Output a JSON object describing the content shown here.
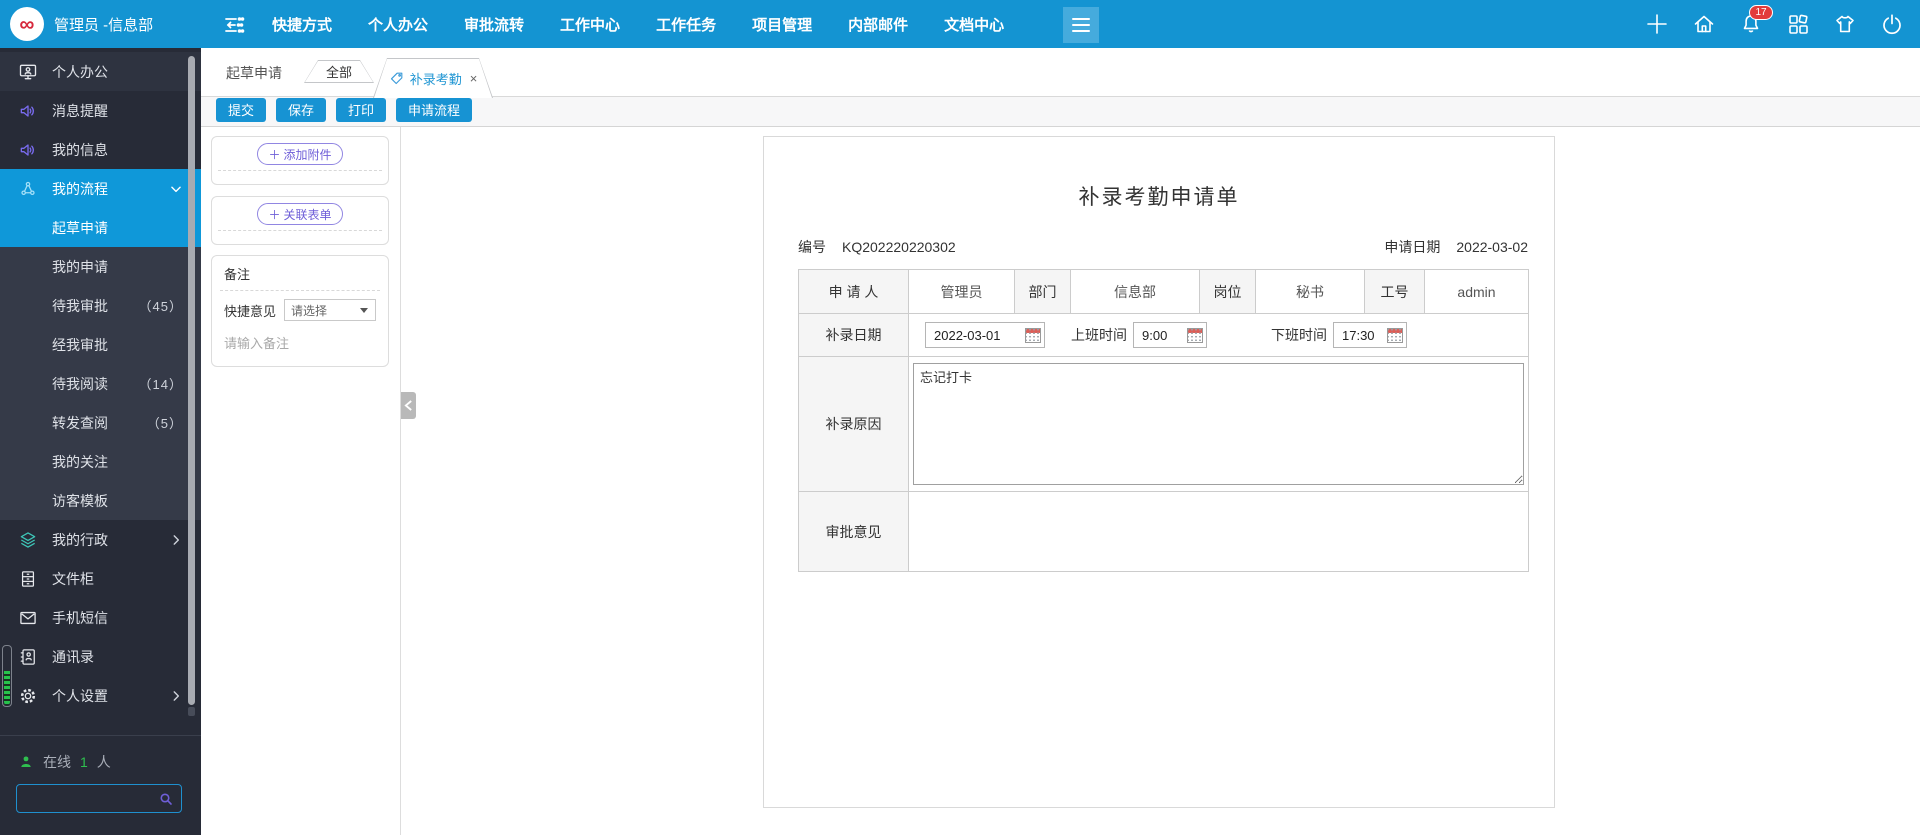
{
  "colors": {
    "topbar_blue": "#1494d2",
    "burger_blue": "#45abdd",
    "sidebar_dark": "#272b37",
    "submenu_dark": "#353a48",
    "highlight_blue": "#0f98d9",
    "button_blue": "#1793d3",
    "accent_purple": "#6f5fd8",
    "badge_red": "#e23b3b",
    "online_green": "#2fbf4f"
  },
  "topbar": {
    "logo_glyph": "∞",
    "user": "管理员 -信息部",
    "menu": [
      "快捷方式",
      "个人办公",
      "审批流转",
      "工作中心",
      "工作任务",
      "项目管理",
      "内部邮件",
      "文档中心"
    ],
    "notification_count": "17"
  },
  "sidebar": {
    "items": [
      {
        "id": "personal-office",
        "label": "个人办公",
        "icon": "monitor-user",
        "section": true
      },
      {
        "id": "message-remind",
        "label": "消息提醒",
        "icon": "speaker",
        "iconClass": "purple"
      },
      {
        "id": "my-info",
        "label": "我的信息",
        "icon": "speaker",
        "iconClass": "purple"
      },
      {
        "id": "my-workflow",
        "label": "我的流程",
        "icon": "flow",
        "active": true,
        "chevron": "down"
      },
      {
        "id": "draft-apply",
        "label": "起草申请",
        "sub": true,
        "active": true
      },
      {
        "id": "my-apply",
        "label": "我的申请",
        "sub": true
      },
      {
        "id": "wait-my-approve",
        "label": "待我审批",
        "sub": true,
        "count": "（45）"
      },
      {
        "id": "approved-by-me",
        "label": "经我审批",
        "sub": true
      },
      {
        "id": "wait-my-read",
        "label": "待我阅读",
        "sub": true,
        "count": "（14）"
      },
      {
        "id": "forward-review",
        "label": "转发查阅",
        "sub": true,
        "count": "（5）"
      },
      {
        "id": "my-follow",
        "label": "我的关注",
        "sub": true
      },
      {
        "id": "visitor-template",
        "label": "访客模板",
        "sub": true
      },
      {
        "id": "my-admin",
        "label": "我的行政",
        "icon": "layers",
        "iconClass": "teal",
        "chevron": "right"
      },
      {
        "id": "file-cabinet",
        "label": "文件柜",
        "icon": "cabinet"
      },
      {
        "id": "sms",
        "label": "手机短信",
        "icon": "mail"
      },
      {
        "id": "contacts",
        "label": "通讯录",
        "icon": "contacts"
      },
      {
        "id": "personal-settings",
        "label": "个人设置",
        "icon": "gear",
        "chevron": "right"
      }
    ],
    "online_label": "在线",
    "online_count": "1",
    "online_unit": "人"
  },
  "tabs": {
    "root_label": "起草申请",
    "all_label": "全部",
    "active_label": "补录考勤",
    "close_glyph": "×"
  },
  "toolbar": {
    "buttons": [
      "提交",
      "保存",
      "打印",
      "申请流程"
    ]
  },
  "side_panel": {
    "plus_glyph": "＋",
    "add_attachment_label": "添加附件",
    "link_form_label": "关联表单",
    "remark_title": "备注",
    "quick_opinion_label": "快捷意见",
    "quick_opinion_value": "请选择",
    "remark_placeholder": "请输入备注"
  },
  "form": {
    "title": "补录考勤申请单",
    "no_label": "编号",
    "no_value": "KQ202220220302",
    "apply_date_label": "申请日期",
    "apply_date_value": "2022-03-02",
    "row_applicant": {
      "label": "申 请 人",
      "name": "管理员",
      "dept_label": "部门",
      "dept_value": "信息部",
      "post_label": "岗位",
      "post_value": "秘书",
      "empno_label": "工号",
      "empno_value": "admin"
    },
    "row_makeup": {
      "label": "补录日期",
      "date_value": "2022-03-01",
      "start_label": "上班时间",
      "start_value": "9:00",
      "end_label": "下班时间",
      "end_value": "17:30"
    },
    "row_reason": {
      "label": "补录原因",
      "value": "忘记打卡"
    },
    "row_approval": {
      "label": "审批意见",
      "value": ""
    }
  }
}
